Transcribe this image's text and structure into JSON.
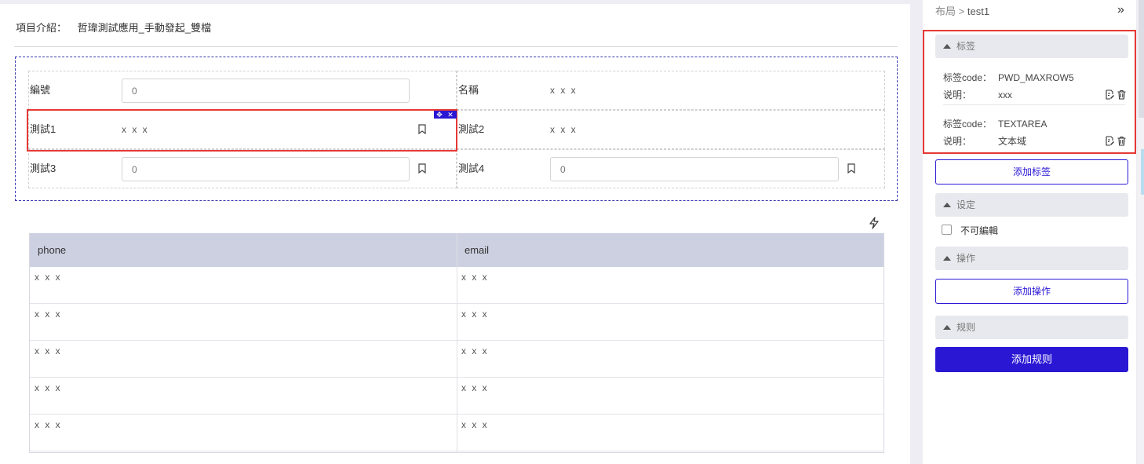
{
  "intro": {
    "label": "項目介紹：",
    "value": "哲瑋測試應用_手動發起_雙檔"
  },
  "form": {
    "fields": [
      {
        "label": "編號",
        "kind": "input",
        "placeholder": "0"
      },
      {
        "label": "名稱",
        "kind": "text",
        "value": "x x x"
      },
      {
        "label": "測試1",
        "kind": "text",
        "value": "x x x"
      },
      {
        "label": "測試2",
        "kind": "text",
        "value": "x x x"
      },
      {
        "label": "測試3",
        "kind": "input",
        "placeholder": "0"
      },
      {
        "label": "測試4",
        "kind": "input",
        "placeholder": "0"
      }
    ],
    "selection_tools": [
      "move-icon",
      "close-icon"
    ]
  },
  "table": {
    "headers": [
      "phone",
      "email"
    ],
    "rows": [
      [
        "x x x",
        "x x x"
      ],
      [
        "x x x",
        "x x x"
      ],
      [
        "x x x",
        "x x x"
      ],
      [
        "x x x",
        "x x x"
      ],
      [
        "x x x",
        "x x x"
      ]
    ]
  },
  "panel": {
    "breadcrumb_parent": "布局",
    "breadcrumb_sep": ">",
    "breadcrumb_current": "test1",
    "expand_glyph": "»",
    "tags_section": "标签",
    "tags": [
      {
        "code_label": "标签code：",
        "code": "PWD_MAXROW5",
        "desc_label": "说明：",
        "desc": "xxx"
      },
      {
        "code_label": "标签code：",
        "code": "TEXTAREA",
        "desc_label": "说明：",
        "desc": "文本域"
      }
    ],
    "add_tag": "添加标签",
    "settings_section": "设定",
    "readonly_label": "不可編輯",
    "readonly_checked": false,
    "actions_section": "操作",
    "add_action": "添加操作",
    "rules_section": "规则",
    "add_rule": "添加规则"
  },
  "colors": {
    "accent": "#2a17d4",
    "highlight": "#e53935",
    "table_header": "#cdd0e1"
  }
}
